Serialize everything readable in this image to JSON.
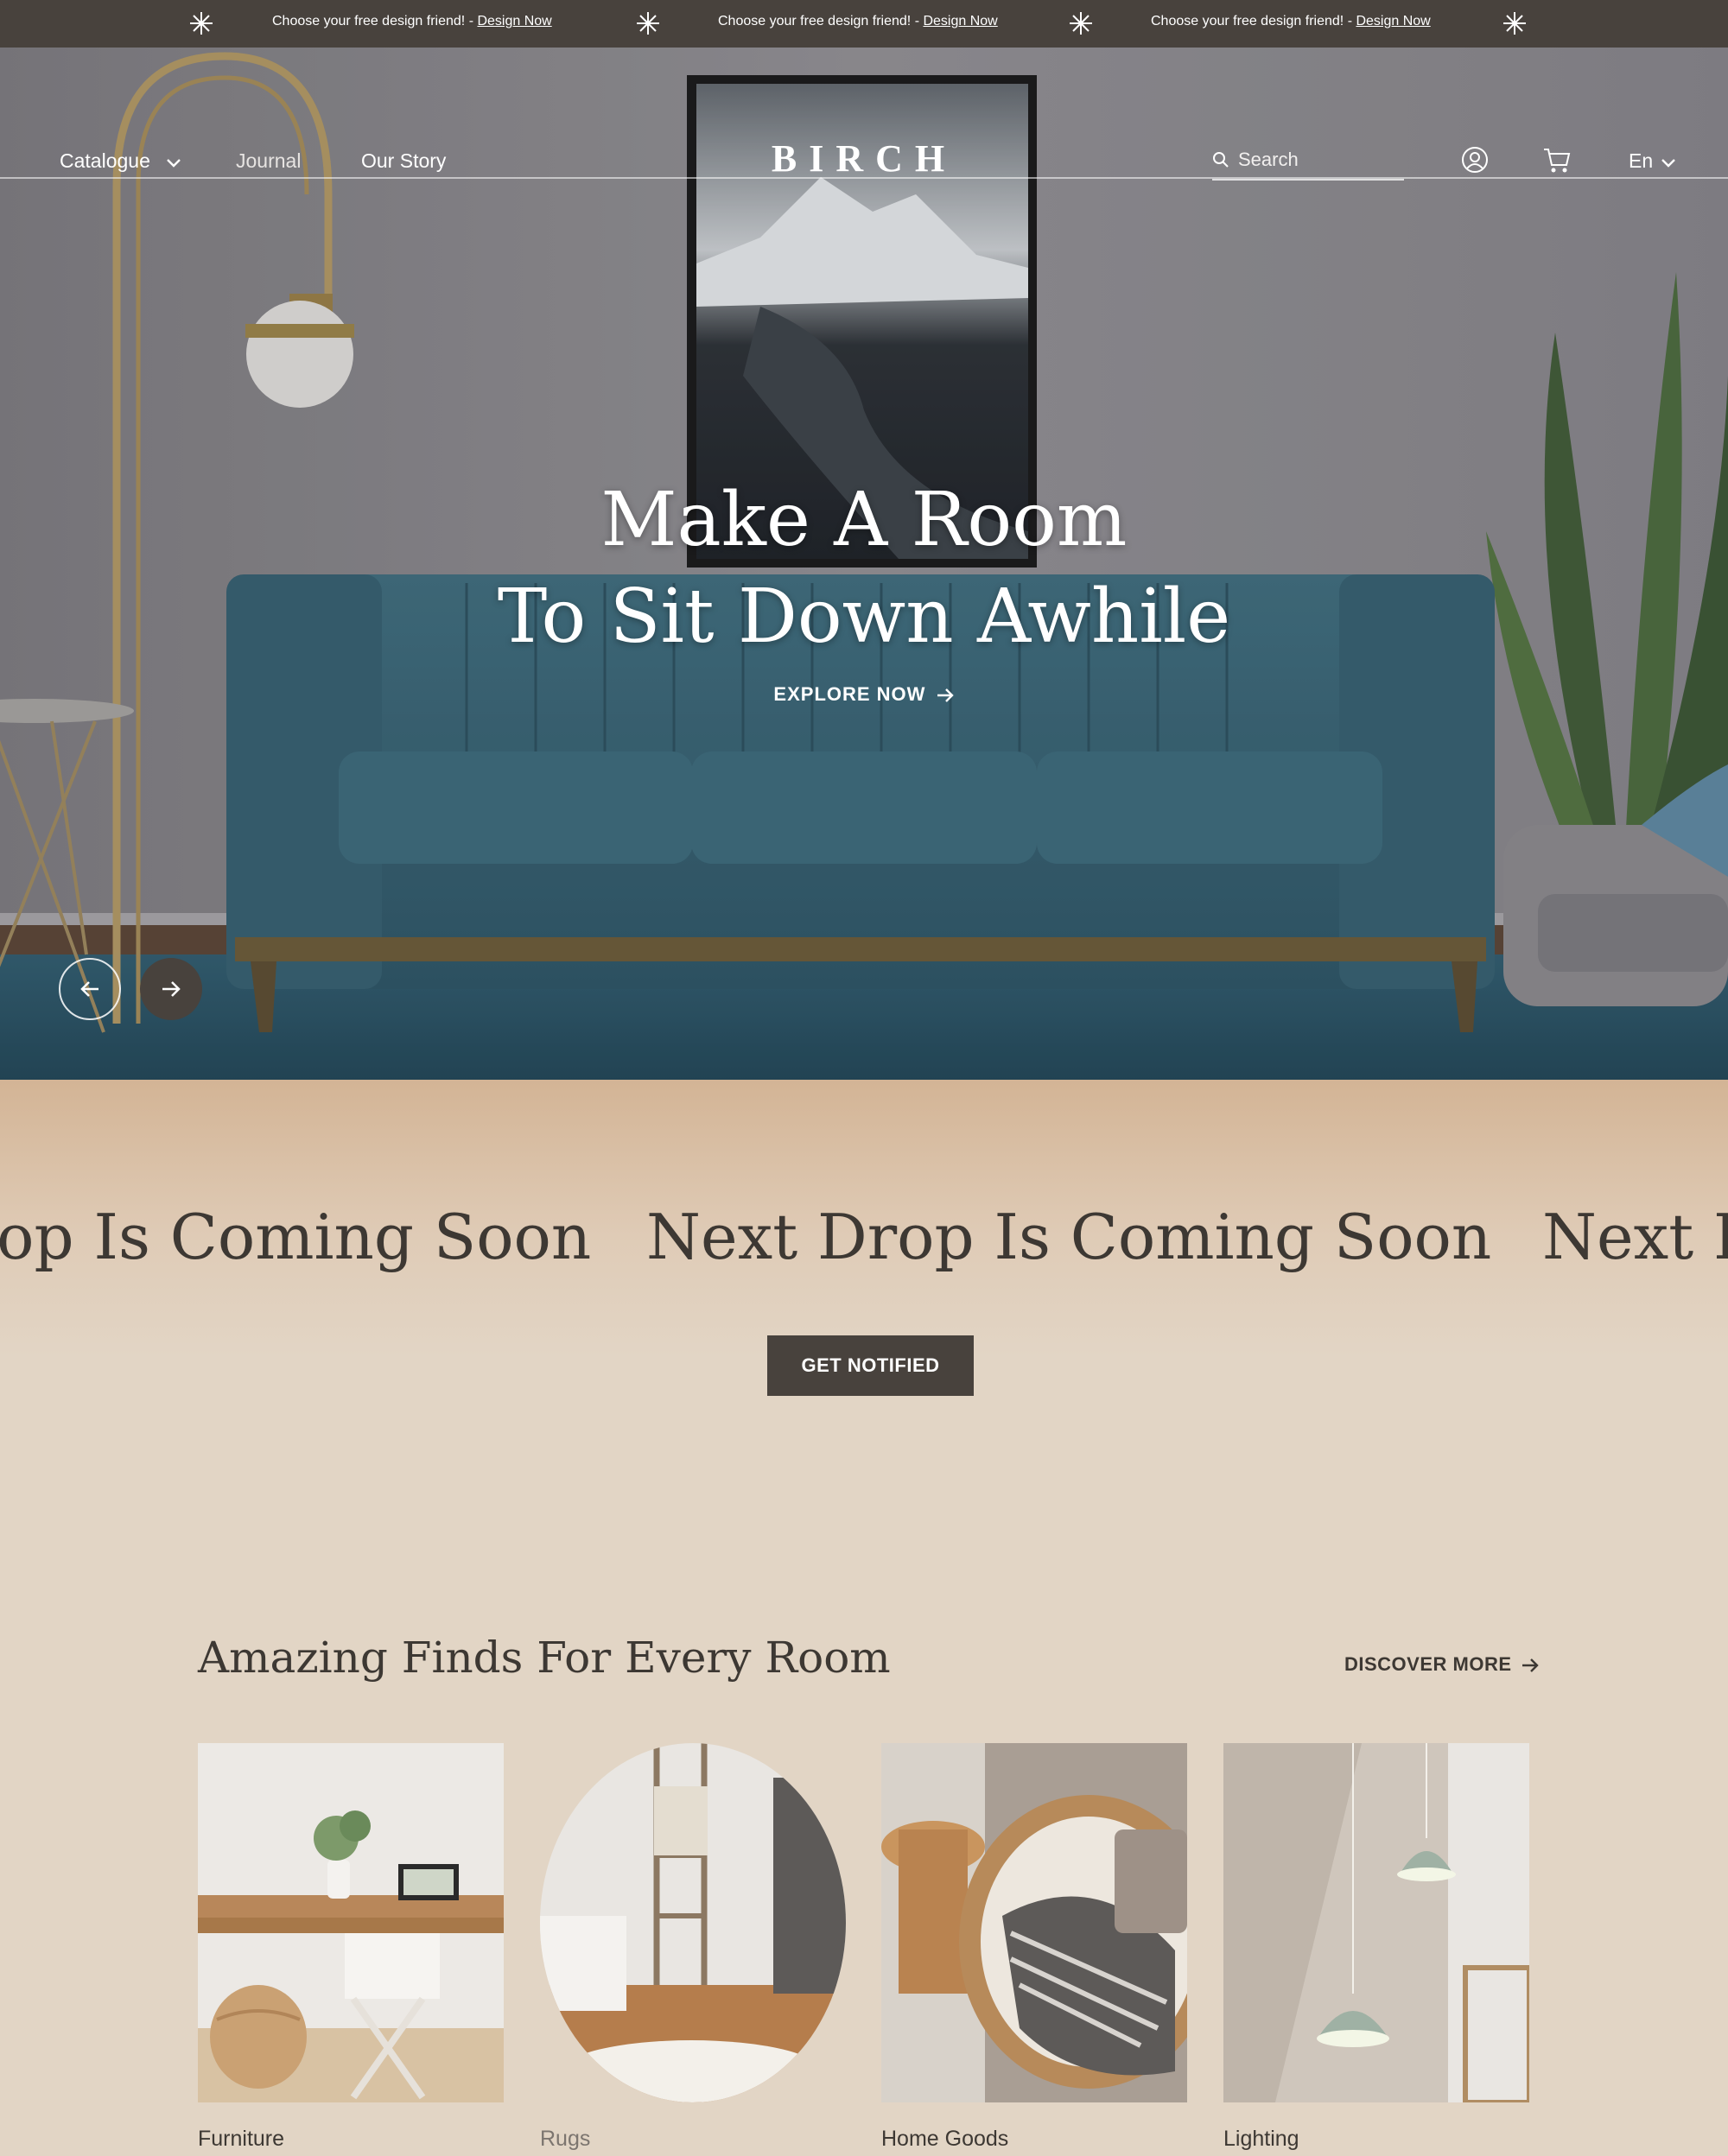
{
  "announcement": {
    "messages": [
      {
        "text": "Choose your free design friend! - ",
        "link": "Design Now"
      },
      {
        "text": "Choose your free design friend! - ",
        "link": "Design Now"
      },
      {
        "text": "Choose your free design friend! - ",
        "link": "Design Now"
      }
    ]
  },
  "nav": {
    "catalogue": "Catalogue",
    "journal": "Journal",
    "our_story": "Our Story",
    "logo": "BIRCH",
    "search_placeholder": "Search",
    "language": "En"
  },
  "hero": {
    "title_line1": "Make A Room",
    "title_line2": "To Sit Down Awhile",
    "cta": "EXPLORE NOW"
  },
  "drop": {
    "marquee": [
      "Next Drop Is Coming Soon",
      "Next Drop Is Coming Soon",
      "Next Drop Is Coming Soon"
    ],
    "button": "GET NOTIFIED"
  },
  "finds": {
    "title": "Amazing Finds For Every Room",
    "discover": "DISCOVER MORE",
    "categories": [
      {
        "label": "Furniture"
      },
      {
        "label": "Rugs"
      },
      {
        "label": "Home Goods"
      },
      {
        "label": "Lighting"
      }
    ]
  },
  "colors": {
    "dark": "#48423d",
    "sand": "#e2d5c5",
    "teal_sofa": "#3c6878"
  }
}
